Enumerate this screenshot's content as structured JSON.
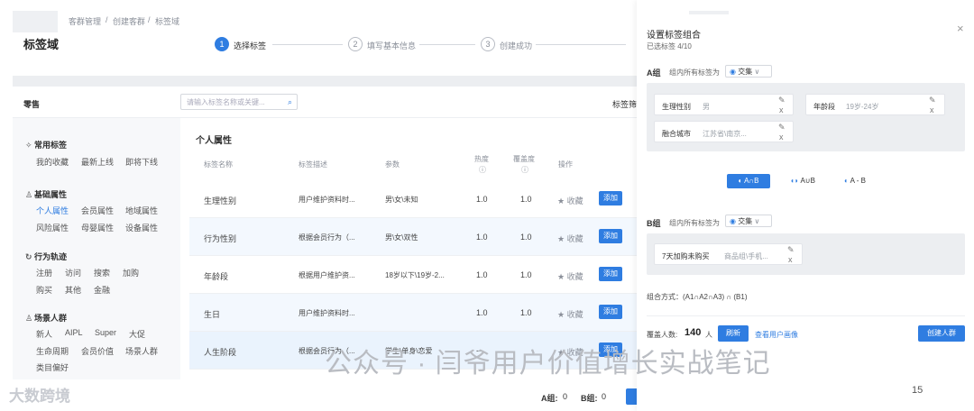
{
  "breadcrumb": {
    "c1": "客群管理",
    "sep1": "/",
    "c2": "创建客群",
    "sep2": "/",
    "c3": "标签域"
  },
  "page_title": "标签域",
  "steps": [
    {
      "num": "1",
      "label": "选择标签"
    },
    {
      "num": "2",
      "label": "填写基本信息"
    },
    {
      "num": "3",
      "label": "创建成功"
    }
  ],
  "left": {
    "section_header": "零售",
    "groups": {
      "common": {
        "title": "常用标签",
        "items": [
          "我的收藏",
          "最新上线",
          "即将下线"
        ]
      },
      "basic": {
        "title": "基础属性",
        "items": [
          "个人属性",
          "会员属性",
          "地域属性",
          "风险属性",
          "母婴属性",
          "设备属性"
        ]
      },
      "behavior": {
        "title": "行为轨迹",
        "items": [
          "注册",
          "访问",
          "搜索",
          "加购",
          "购买",
          "其他",
          "金融"
        ]
      },
      "scene": {
        "title": "场景人群",
        "items": [
          "新人",
          "AIPL",
          "Super",
          "大促",
          "生命周期",
          "会员价值",
          "场景人群",
          "类目偏好"
        ]
      }
    }
  },
  "search": {
    "placeholder": "请输入标签名称或关键..."
  },
  "tag_filter_label": "标签筛",
  "table": {
    "section": "个人属性",
    "headers": {
      "name": "标签名称",
      "desc": "标签描述",
      "param": "参数",
      "heat": "热度",
      "coverage": "覆盖度",
      "op": "操作"
    },
    "rows": [
      {
        "name": "生理性别",
        "desc": "用户维护资料时...",
        "param": "男\\女\\未知",
        "heat": "1.0",
        "cov": "1.0",
        "fav": "收藏",
        "add": "添加"
      },
      {
        "name": "行为性别",
        "desc": "根据会员行为（...",
        "param": "男\\女\\双性",
        "heat": "1.0",
        "cov": "1.0",
        "fav": "收藏",
        "add": "添加"
      },
      {
        "name": "年龄段",
        "desc": "根据用户维护资...",
        "param": "18岁以下\\19岁-2...",
        "heat": "1.0",
        "cov": "1.0",
        "fav": "收藏",
        "add": "添加"
      },
      {
        "name": "生日",
        "desc": "用户维护资料时...",
        "param": "",
        "heat": "1.0",
        "cov": "1.0",
        "fav": "收藏",
        "add": "添加"
      },
      {
        "name": "人生阶段",
        "desc": "根据会员行为（...",
        "param": "学生\\单身\\恋爱",
        "heat": "--",
        "cov": "",
        "fav": "收藏",
        "add": "添加"
      }
    ]
  },
  "footer": {
    "a_label": "A组:",
    "a_val": "0",
    "b_label": "B组:",
    "b_val": "0",
    "button": "设置标签组合"
  },
  "panel": {
    "title": "设置标签组合",
    "selected": "已选标签 4/10",
    "close": "×",
    "groupA": {
      "name": "A组",
      "rule_label": "组内所有标签为",
      "rule": "交集",
      "chips": [
        {
          "name": "生理性别",
          "val": "男"
        },
        {
          "name": "年龄段",
          "val": "19岁-24岁"
        },
        {
          "name": "融合城市",
          "val": "江苏省\\南京..."
        }
      ]
    },
    "ops": {
      "and": "A∩B",
      "or": "A∪B",
      "minus": "A - B"
    },
    "groupB": {
      "name": "B组",
      "rule_label": "组内所有标签为",
      "rule": "交集",
      "chips": [
        {
          "name": "7天加购未购买",
          "val": "商品组\\手机..."
        }
      ]
    },
    "combine": "组合方式：(A1∩A2∩A3) ∩ (B1)",
    "coverage_label": "覆盖人数:",
    "coverage_num": "140",
    "coverage_unit": "人",
    "refresh": "刷新",
    "view_profile": "查看用户画像",
    "create": "创建人群"
  },
  "watermark": "公众号 · 闫爷用户价值增长实战笔记",
  "watermark2": "大数跨境",
  "page_number": "15"
}
